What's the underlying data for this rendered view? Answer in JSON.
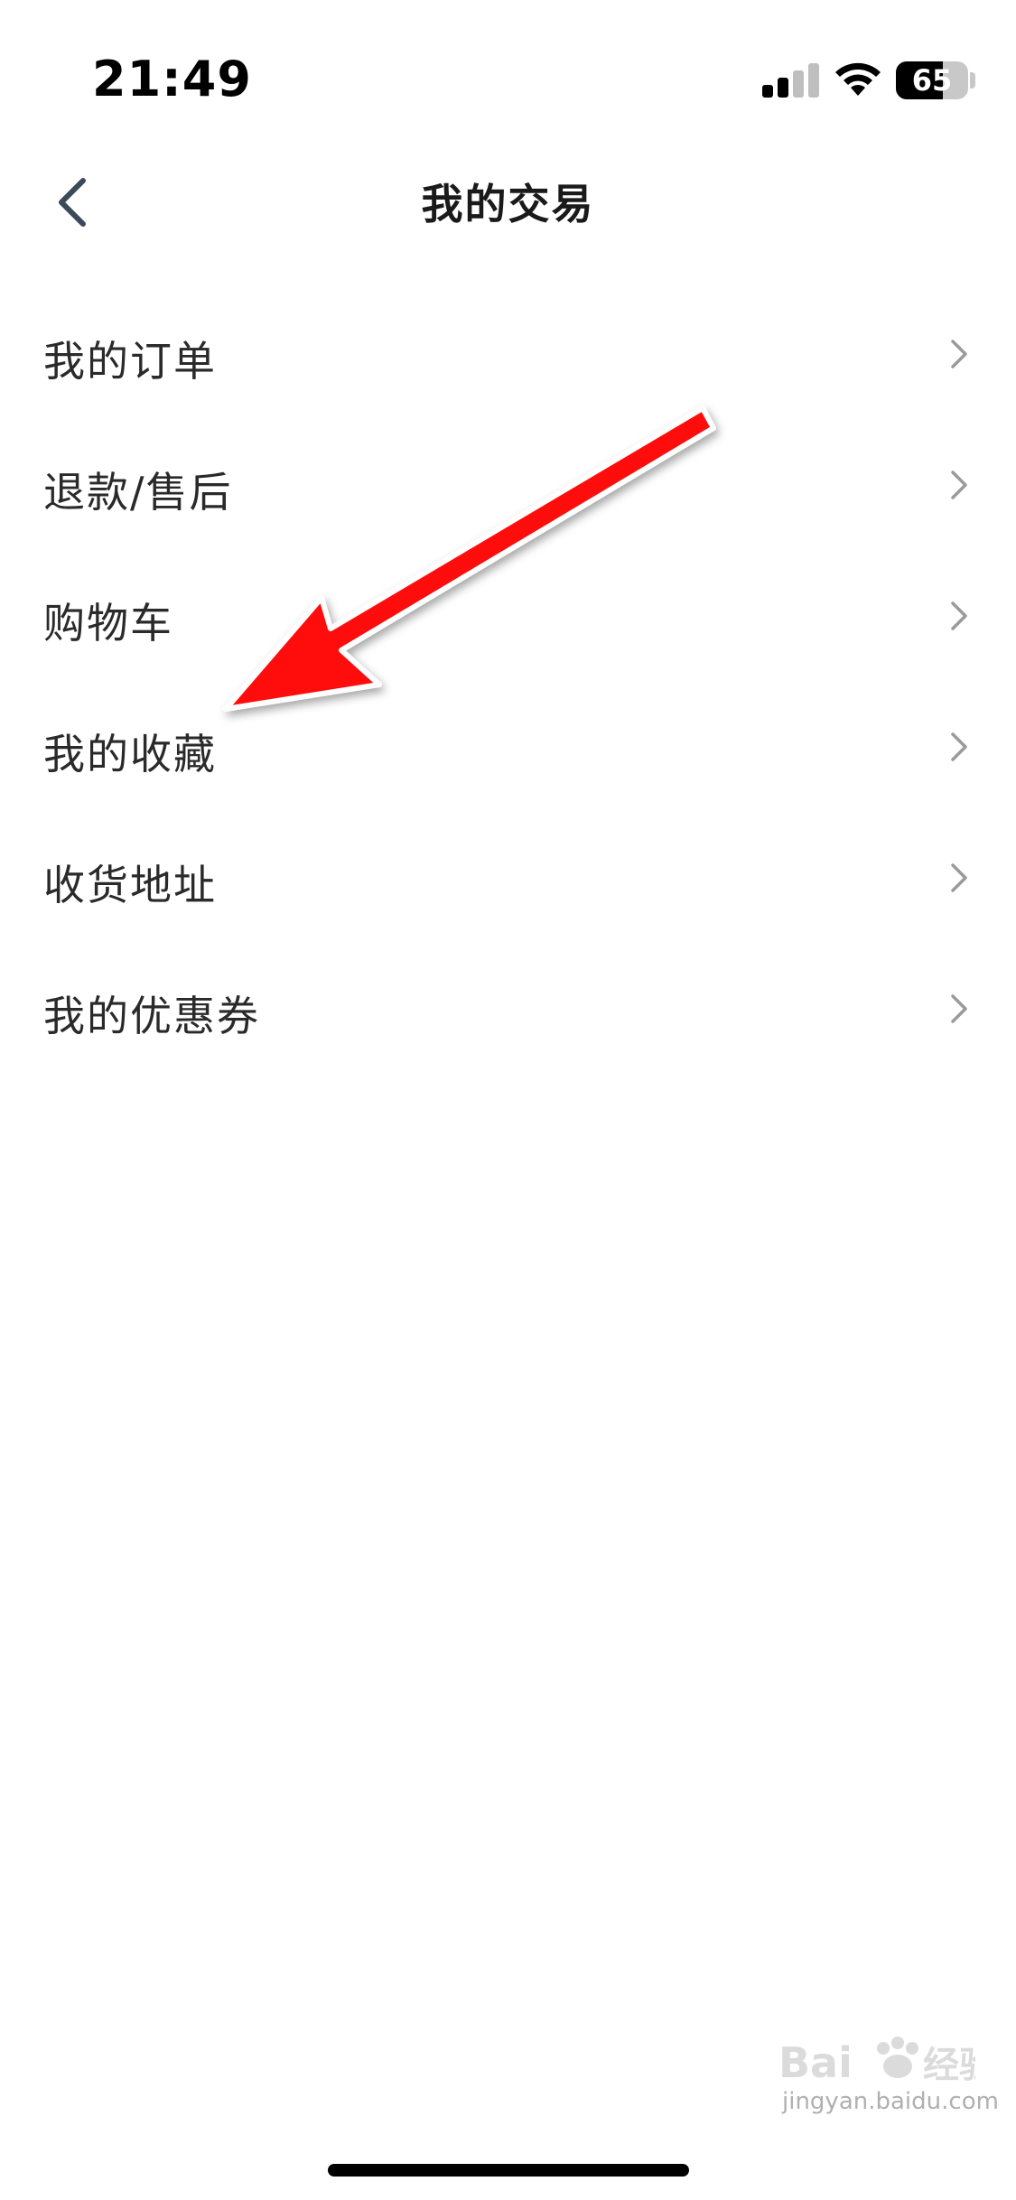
{
  "status_bar": {
    "time": "21:49",
    "battery_percent": "65",
    "battery_level": 0.65,
    "signal_bars_filled": 2,
    "signal_bars_total": 4
  },
  "nav": {
    "title": "我的交易",
    "back_icon": "chevron-left-icon"
  },
  "menu": {
    "items": [
      {
        "label": "我的订单"
      },
      {
        "label": "退款/售后"
      },
      {
        "label": "购物车"
      },
      {
        "label": "我的收藏"
      },
      {
        "label": "收货地址"
      },
      {
        "label": "我的优惠券"
      }
    ],
    "chevron_icon": "chevron-right-icon"
  },
  "annotation": {
    "arrow_color": "#ff0a0a"
  },
  "watermark": {
    "text": "jingyan.baidu.com"
  },
  "colors": {
    "text": "#2a2a2a",
    "title": "#1a1a1a",
    "chevron": "#9a9a9a",
    "back": "#3a4a5a"
  }
}
